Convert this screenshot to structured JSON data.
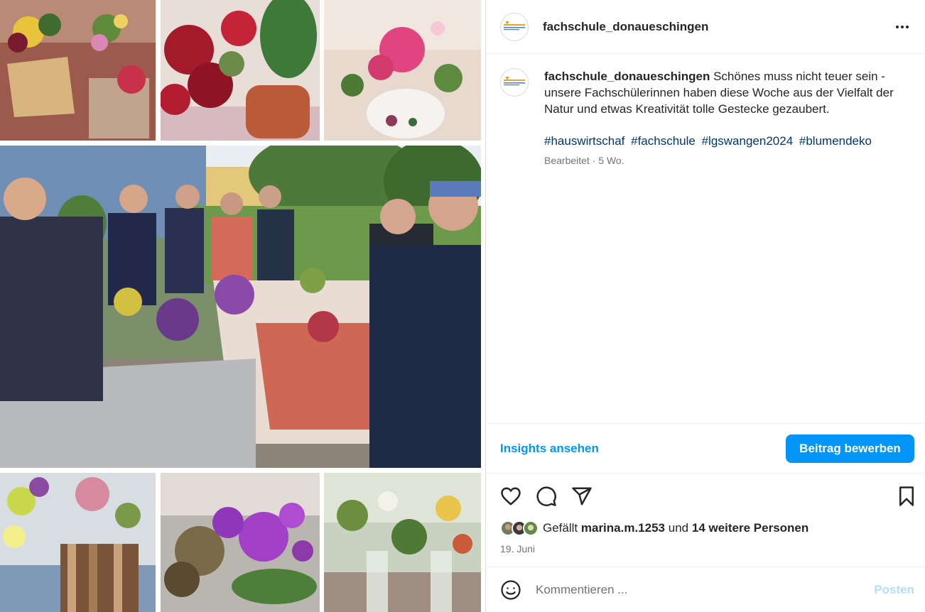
{
  "post": {
    "username": "fachschule_donaueschingen",
    "caption": "Schönes muss nicht teuer sein - unsere Fachschülerinnen haben diese Woche aus der Vielfalt der Natur und etwas Kreativität tolle Gestecke gezaubert.",
    "hashtags": [
      "#hauswirtschaf",
      "#fachschule",
      "#lgswangen2024",
      "#blumendeko"
    ],
    "edited_label": "Bearbeitet",
    "age": "5 Wo.",
    "insights_label": "Insights ansehen",
    "promote_label": "Beitrag bewerben",
    "likes_prefix": "Gefällt",
    "likes_user": "marina.m.1253",
    "likes_and": "und",
    "likes_others": "14 weitere Personen",
    "date": "19. Juni",
    "comment_placeholder": "Kommentieren ...",
    "post_button": "Posten"
  },
  "icons": {
    "more": "more-horizontal-icon",
    "like": "heart-icon",
    "comment": "comment-bubble-icon",
    "share": "paper-plane-icon",
    "save": "bookmark-icon",
    "emoji": "emoji-smile-icon"
  },
  "colors": {
    "link": "#0095f6",
    "hashtag": "#00376b",
    "muted": "#737373",
    "border": "#dbdbdb"
  }
}
